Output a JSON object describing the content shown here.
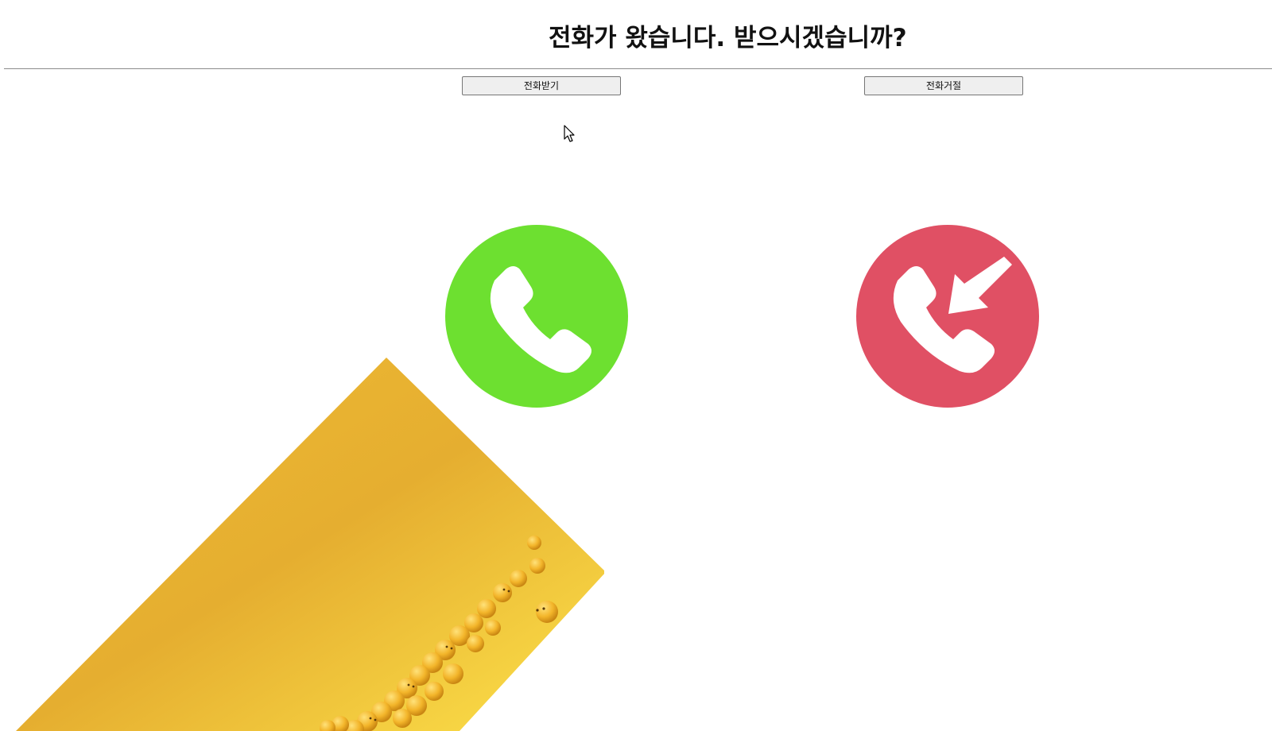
{
  "header": {
    "title": "전화가 왔습니다. 받으시겠습니까?"
  },
  "buttons": {
    "accept_label": "전화받기",
    "decline_label": "전화거절"
  },
  "icons": {
    "accept": "phone-accept-icon",
    "decline": "phone-incoming-decline-icon",
    "cursor": "mouse-pointer-icon"
  },
  "image": {
    "subject": "yellow smiley balls wallpaper"
  },
  "colors": {
    "accept": "#6de030",
    "decline": "#e05064",
    "wallpaper_primary": "#f2c23a",
    "wallpaper_highlight": "#ffe04a"
  }
}
